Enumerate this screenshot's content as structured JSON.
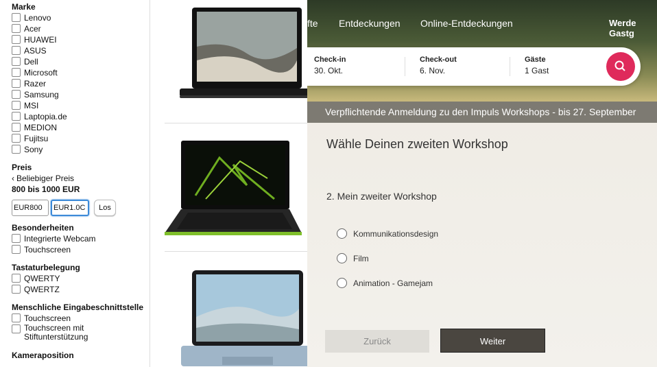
{
  "sidebar": {
    "brand_title": "Marke",
    "brands": [
      "Lenovo",
      "Acer",
      "HUAWEI",
      "ASUS",
      "Dell",
      "Microsoft",
      "Razer",
      "Samsung",
      "MSI",
      "Laptopia.de",
      "MEDION",
      "Fujitsu",
      "Sony"
    ],
    "price_title": "Preis",
    "price_any": "Beliebiger Preis",
    "price_range": "800 bis 1000 EUR",
    "price_min": "EUR800",
    "price_max": "EUR1.0C",
    "go_label": "Los",
    "features_title": "Besonderheiten",
    "features": [
      "Integrierte Webcam",
      "Touchscreen"
    ],
    "keyboard_title": "Tastaturbelegung",
    "keyboards": [
      "QWERTY",
      "QWERTZ"
    ],
    "hid_title": "Menschliche Eingabeschnittstelle",
    "hid": [
      "Touchscreen",
      "Touchscreen mit Stiftunterstützung"
    ],
    "camera_title": "Kameraposition"
  },
  "header": {
    "nav": [
      "fte",
      "Entdeckungen",
      "Online-Entdeckungen",
      "Werde Gastg"
    ],
    "checkin_label": "Check-in",
    "checkin_value": "30. Okt.",
    "checkout_label": "Check-out",
    "checkout_value": "6. Nov.",
    "guests_label": "Gäste",
    "guests_value": "1 Gast",
    "search_color": "#df2a5b"
  },
  "workshop": {
    "banner": "Verpflichtende Anmeldung  zu den Impuls Workshops - bis 27. September",
    "title": "Wähle Deinen zweiten Workshop",
    "question": "2. Mein zweiter Workshop",
    "options": [
      "Kommunikationsdesign",
      "Film",
      "Animation - Gamejam"
    ],
    "back_label": "Zurück",
    "next_label": "Weiter"
  }
}
